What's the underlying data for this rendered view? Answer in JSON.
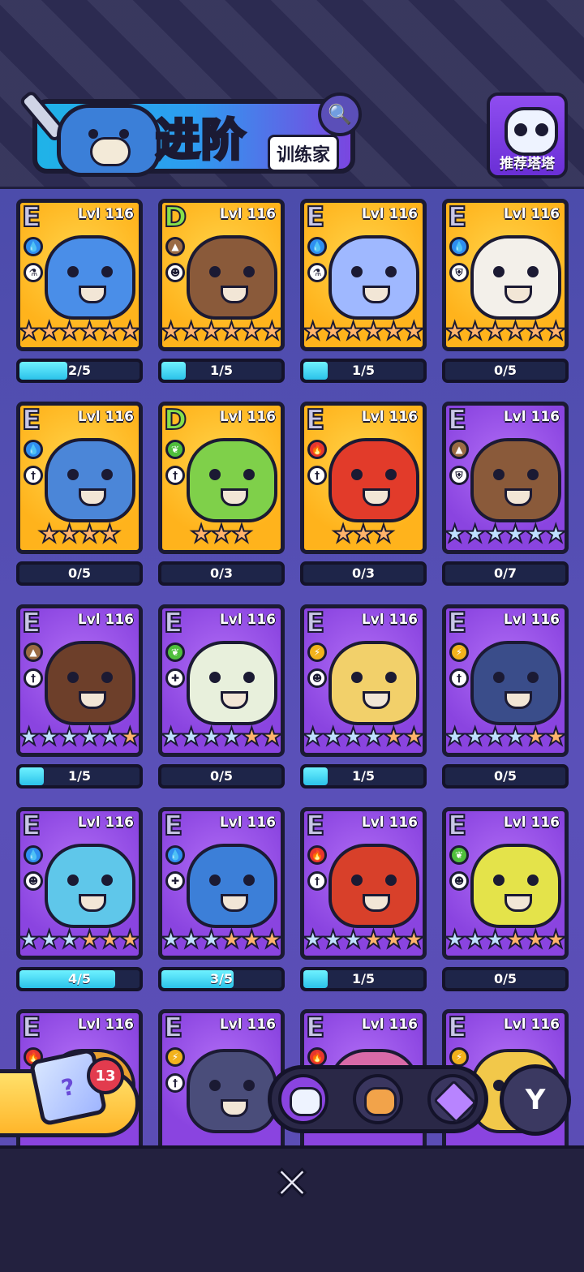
{
  "header": {
    "title": "进阶",
    "subtitle": "训练家",
    "search_icon": "search-icon",
    "recommend_label": "推荐塔塔"
  },
  "cards": [
    {
      "grade": "E",
      "level": "Lvl 116",
      "bg": "gold",
      "element": "water",
      "role": "potion",
      "stars": [
        "b",
        "b",
        "b",
        "b",
        "b",
        "b"
      ],
      "progress": "2/5",
      "fill": 0.4,
      "body": "#4a8ee8"
    },
    {
      "grade": "D",
      "level": "Lvl 116",
      "bg": "gold",
      "element": "earth",
      "role": "ghost",
      "stars": [
        "b",
        "b",
        "b",
        "b",
        "b",
        "b"
      ],
      "progress": "1/5",
      "fill": 0.2,
      "body": "#8a5a3a"
    },
    {
      "grade": "E",
      "level": "Lvl 116",
      "bg": "gold",
      "element": "water",
      "role": "potion",
      "stars": [
        "b",
        "b",
        "b",
        "b",
        "b",
        "b"
      ],
      "progress": "1/5",
      "fill": 0.2,
      "body": "#9fb8ff"
    },
    {
      "grade": "E",
      "level": "Lvl 116",
      "bg": "gold",
      "element": "water",
      "role": "shield",
      "stars": [
        "b",
        "b",
        "b",
        "b",
        "b",
        "b"
      ],
      "progress": "0/5",
      "fill": 0,
      "body": "#f3f0ea"
    },
    {
      "grade": "E",
      "level": "Lvl 116",
      "bg": "gold",
      "element": "water",
      "role": "sword",
      "stars": [
        "b",
        "b",
        "b",
        "b"
      ],
      "progress": "0/5",
      "fill": 0,
      "body": "#4b86d8"
    },
    {
      "grade": "D",
      "level": "Lvl 116",
      "bg": "gold",
      "element": "grass",
      "role": "sword",
      "stars": [
        "b",
        "b",
        "b"
      ],
      "progress": "0/3",
      "fill": 0,
      "body": "#7fd04a"
    },
    {
      "grade": "E",
      "level": "Lvl 116",
      "bg": "gold",
      "element": "fire",
      "role": "sword",
      "stars": [
        "b",
        "b",
        "b"
      ],
      "progress": "0/3",
      "fill": 0,
      "body": "#e23b2a"
    },
    {
      "grade": "E",
      "level": "Lvl 116",
      "bg": "purple",
      "element": "earth",
      "role": "shield",
      "stars": [
        "s",
        "s",
        "s",
        "s",
        "s",
        "s"
      ],
      "progress": "0/7",
      "fill": 0,
      "body": "#8a5a3a"
    },
    {
      "grade": "E",
      "level": "Lvl 116",
      "bg": "purple",
      "element": "earth",
      "role": "sword",
      "stars": [
        "s",
        "s",
        "s",
        "s",
        "s",
        "b"
      ],
      "progress": "1/5",
      "fill": 0.2,
      "body": "#6d3f2a"
    },
    {
      "grade": "E",
      "level": "Lvl 116",
      "bg": "purple",
      "element": "grass",
      "role": "heal",
      "stars": [
        "s",
        "s",
        "s",
        "s",
        "b",
        "b"
      ],
      "progress": "0/5",
      "fill": 0,
      "body": "#e8f0dc"
    },
    {
      "grade": "E",
      "level": "Lvl 116",
      "bg": "purple",
      "element": "thunder",
      "role": "ghost",
      "stars": [
        "s",
        "s",
        "s",
        "s",
        "b",
        "b"
      ],
      "progress": "1/5",
      "fill": 0.2,
      "body": "#f2d06a"
    },
    {
      "grade": "E",
      "level": "Lvl 116",
      "bg": "purple",
      "element": "thunder",
      "role": "sword",
      "stars": [
        "s",
        "s",
        "s",
        "s",
        "b",
        "b"
      ],
      "progress": "0/5",
      "fill": 0,
      "body": "#3a4d8a"
    },
    {
      "grade": "E",
      "level": "Lvl 116",
      "bg": "purple",
      "element": "water",
      "role": "ghost",
      "stars": [
        "s",
        "s",
        "s",
        "b",
        "b",
        "b"
      ],
      "progress": "4/5",
      "fill": 0.8,
      "body": "#5fc7ea"
    },
    {
      "grade": "E",
      "level": "Lvl 116",
      "bg": "purple",
      "element": "water",
      "role": "heal",
      "stars": [
        "s",
        "s",
        "s",
        "b",
        "b",
        "b"
      ],
      "progress": "3/5",
      "fill": 0.6,
      "body": "#3c7fd8"
    },
    {
      "grade": "E",
      "level": "Lvl 116",
      "bg": "purple",
      "element": "fire",
      "role": "sword",
      "stars": [
        "s",
        "s",
        "s",
        "b",
        "b",
        "b"
      ],
      "progress": "1/5",
      "fill": 0.2,
      "body": "#d8402a"
    },
    {
      "grade": "E",
      "level": "Lvl 116",
      "bg": "purple",
      "element": "grass",
      "role": "ghost",
      "stars": [
        "s",
        "s",
        "s",
        "b",
        "b",
        "b"
      ],
      "progress": "0/5",
      "fill": 0,
      "body": "#e4e34a"
    },
    {
      "grade": "E",
      "level": "Lvl 116",
      "bg": "purple",
      "element": "fire",
      "role": "",
      "stars": [],
      "progress": "",
      "fill": 0,
      "body": "#e8a030"
    },
    {
      "grade": "E",
      "level": "Lvl 116",
      "bg": "purple",
      "element": "thunder",
      "role": "sword",
      "stars": [],
      "progress": "",
      "fill": 0,
      "body": "#4a4d7a"
    },
    {
      "grade": "E",
      "level": "Lvl 116",
      "bg": "purple",
      "element": "fire",
      "role": "",
      "stars": [],
      "progress": "",
      "fill": 0,
      "body": "#d86aa8"
    },
    {
      "grade": "E",
      "level": "Lvl 116",
      "bg": "purple",
      "element": "thunder",
      "role": "",
      "stars": [],
      "progress": "",
      "fill": 0,
      "body": "#f2c84a"
    }
  ],
  "gacha": {
    "count": "13",
    "icon": "?"
  },
  "tabs": [
    "tata-face-icon",
    "bear-face-icon",
    "star-gem-icon"
  ],
  "filter_icon": "filter-icon",
  "close_icon": "close-icon",
  "colors": {
    "water": "#2f8ef0",
    "earth": "#9a6b44",
    "grass": "#4fbf3c",
    "fire": "#e8362c",
    "thunder": "#f2b21c"
  }
}
